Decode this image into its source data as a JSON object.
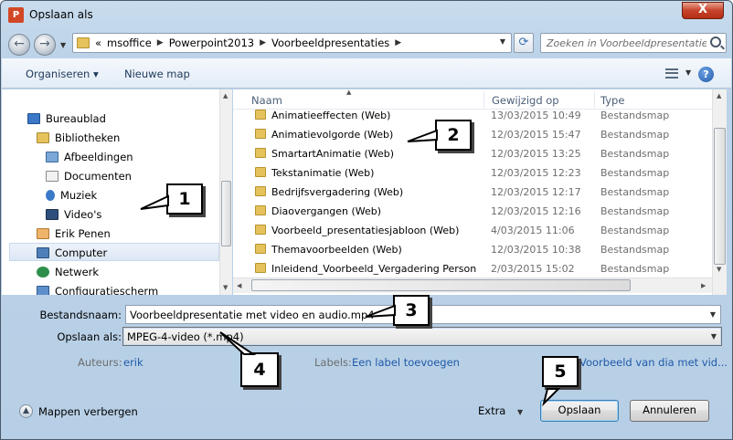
{
  "window": {
    "title": "Opslaan als",
    "close_label": "X"
  },
  "app_icon_label": "P",
  "address": {
    "breadcrumb": [
      "«",
      "msoffice",
      "Powerpoint2013",
      "Voorbeeldpresentaties"
    ]
  },
  "search": {
    "placeholder": "Zoeken in Voorbeeldpresentatie..."
  },
  "toolbar": {
    "organize_label": "Organiseren ▾",
    "new_folder_label": "Nieuwe map",
    "help_label": "?"
  },
  "nav_items": [
    {
      "label": "Bureaublad",
      "icon": "desktop-icon"
    },
    {
      "label": "Bibliotheken",
      "icon": "libraries-icon"
    },
    {
      "label": "Afbeeldingen",
      "icon": "pictures-icon"
    },
    {
      "label": "Documenten",
      "icon": "documents-icon"
    },
    {
      "label": "Muziek",
      "icon": "music-icon"
    },
    {
      "label": "Video's",
      "icon": "videos-icon"
    },
    {
      "label": "Erik Penen",
      "icon": "user-folder-icon"
    },
    {
      "label": "Computer",
      "icon": "computer-icon"
    },
    {
      "label": "Netwerk",
      "icon": "network-icon"
    },
    {
      "label": "Configuratiescherm",
      "icon": "control-panel-icon"
    }
  ],
  "columns": {
    "name": "Naam",
    "date": "Gewijzigd op",
    "type": "Type"
  },
  "files": [
    {
      "name": "Animatieeffecten (Web)",
      "date": "13/03/2015 10:49",
      "type": "Bestandsmap"
    },
    {
      "name": "Animatievolgorde (Web)",
      "date": "12/03/2015 15:47",
      "type": "Bestandsmap"
    },
    {
      "name": "SmartartAnimatie (Web)",
      "date": "12/03/2015 13:25",
      "type": "Bestandsmap"
    },
    {
      "name": "Tekstanimatie (Web)",
      "date": "12/03/2015 12:23",
      "type": "Bestandsmap"
    },
    {
      "name": "Bedrijfsvergadering (Web)",
      "date": "12/03/2015 12:17",
      "type": "Bestandsmap"
    },
    {
      "name": "Diaovergangen (Web)",
      "date": "12/03/2015 12:16",
      "type": "Bestandsmap"
    },
    {
      "name": "Voorbeeld_presentatiesjabloon (Web)",
      "date": "4/03/2015 11:06",
      "type": "Bestandsmap"
    },
    {
      "name": "Themavoorbeelden (Web)",
      "date": "12/03/2015 10:38",
      "type": "Bestandsmap"
    },
    {
      "name": "Inleidend_Voorbeeld_Vergadering Person...",
      "date": "2/03/2015 15:02",
      "type": "Bestandsmap"
    }
  ],
  "form": {
    "filename_label": "Bestandsnaam:",
    "filename_value": "Voorbeeldpresentatie  met video en audio.mp4",
    "saveas_label": "Opslaan als:",
    "saveas_value": "MPEG-4-video (*.mp4)",
    "authors_label": "Auteurs:",
    "authors_value": "erik",
    "labels_label": "Labels:",
    "labels_value": "Een label toevoegen",
    "thumb_value": "Voorbeeld van dia met vid..."
  },
  "footer": {
    "hide_folders_label": "Mappen verbergen",
    "extra_label": "Extra",
    "save_label": "Opslaan",
    "cancel_label": "Annuleren"
  },
  "callouts": [
    "1",
    "2",
    "3",
    "4",
    "5"
  ]
}
